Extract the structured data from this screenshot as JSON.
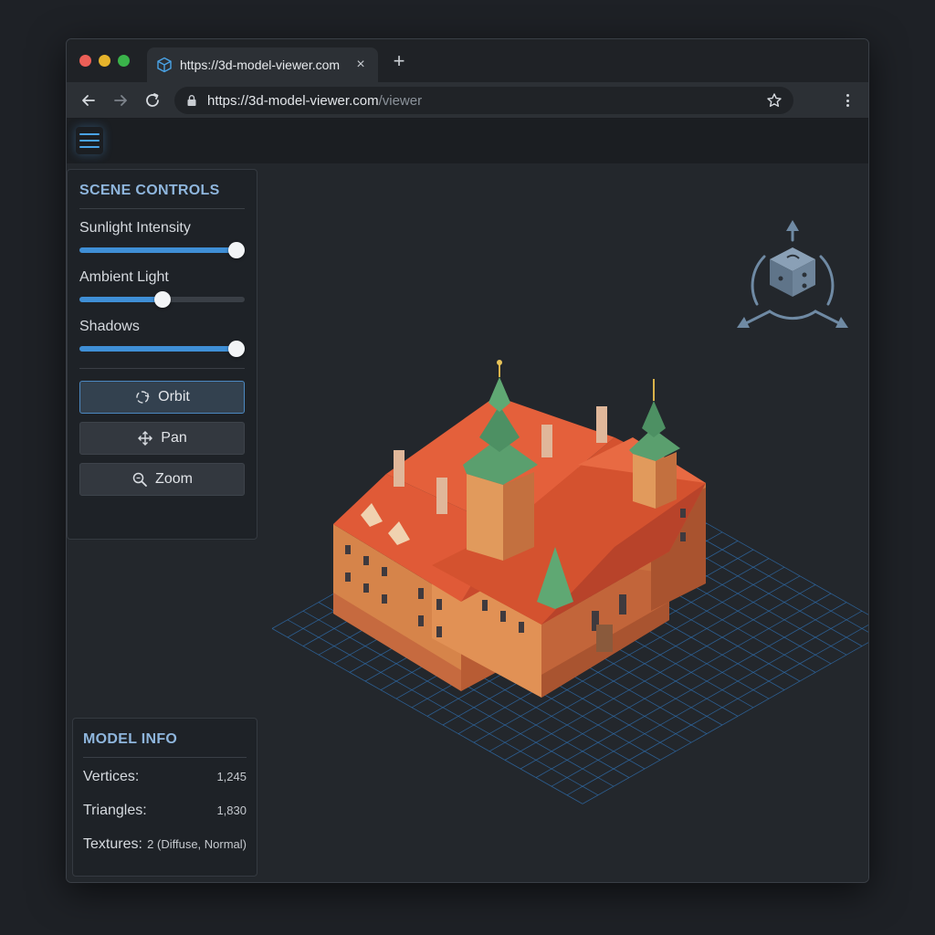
{
  "browser": {
    "tab_title": "https://3d-model-viewer.com",
    "tab_close": "×",
    "new_tab": "+",
    "url_host": "https://3d-model-viewer.com",
    "url_path": "/viewer",
    "colors": {
      "close": "#ec5f57",
      "minimize": "#e5b32b",
      "maximize": "#3ab34a"
    }
  },
  "scene_controls": {
    "title": "SCENE CONTROLS",
    "sliders": [
      {
        "label": "Sunlight Intensity",
        "value": 1.0
      },
      {
        "label": "Ambient Light",
        "value": 0.5
      },
      {
        "label": "Shadows",
        "value": 1.0
      }
    ],
    "modes": [
      {
        "label": "Orbit",
        "icon": "orbit-icon",
        "active": true
      },
      {
        "label": "Pan",
        "icon": "pan-icon",
        "active": false
      },
      {
        "label": "Zoom",
        "icon": "zoom-icon",
        "active": false
      }
    ]
  },
  "model_info": {
    "title": "MODEL INFO",
    "rows": [
      {
        "key": "Vertices:",
        "value": "1,245"
      },
      {
        "key": "Triangles:",
        "value": "1,830"
      },
      {
        "key": "Textures:",
        "value": "2 (Diffuse, Normal)"
      }
    ]
  },
  "theme": {
    "accent": "#3f8fd6",
    "panel_title": "#8fb6dd",
    "grid": "#2f6fb0"
  }
}
